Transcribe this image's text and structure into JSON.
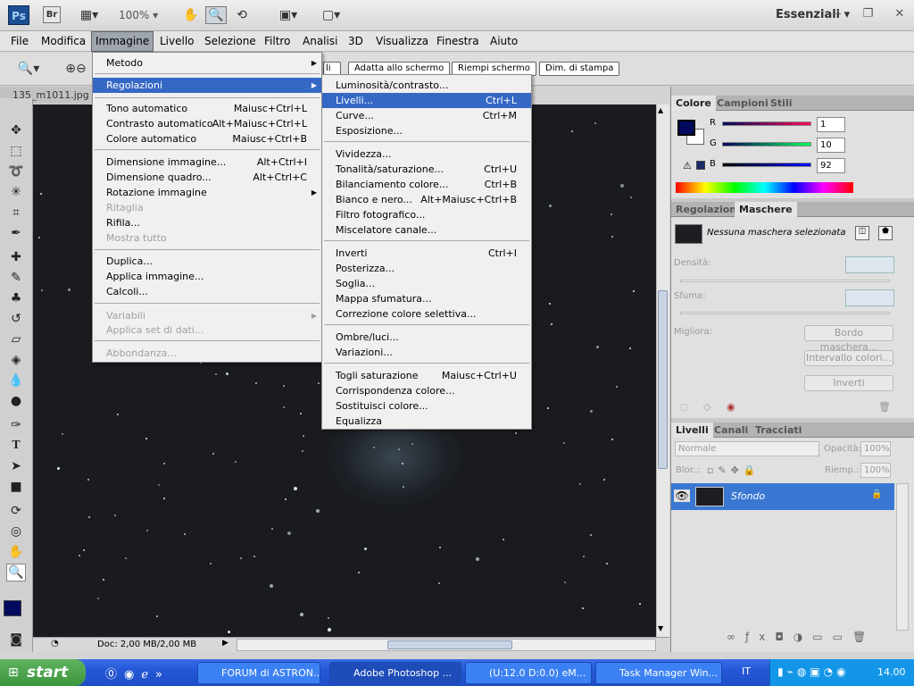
{
  "appbar": {
    "ps_label": "Ps",
    "br_label": "Br",
    "zoom": "100%",
    "workspace": "Essenziali",
    "win_controls": "– ❐ ✕"
  },
  "menubar": [
    "File",
    "Modifica",
    "Immagine",
    "Livello",
    "Selezione",
    "Filtro",
    "Analisi",
    "3D",
    "Visualizza",
    "Finestra",
    "Aiuto"
  ],
  "options": {
    "buttons": [
      "li",
      "Adatta allo schermo",
      "Riempi schermo",
      "Dim. di stampa"
    ]
  },
  "document": {
    "tab": "135_m1011.jpg",
    "status": "Doc: 2,00 MB/2,00 MB"
  },
  "immagine_menu": [
    {
      "label": "Metodo",
      "shortcut": "",
      "submenu": true,
      "disabled": false
    },
    {
      "label": "Regolazioni",
      "shortcut": "",
      "submenu": true,
      "disabled": false,
      "highlight": true
    },
    {
      "label": "Tono automatico",
      "shortcut": "Maiusc+Ctrl+L",
      "disabled": false
    },
    {
      "label": "Contrasto automatico",
      "shortcut": "Alt+Maiusc+Ctrl+L",
      "disabled": false
    },
    {
      "label": "Colore automatico",
      "shortcut": "Maiusc+Ctrl+B",
      "disabled": false
    },
    {
      "label": "Dimensione immagine...",
      "shortcut": "Alt+Ctrl+I",
      "disabled": false
    },
    {
      "label": "Dimensione quadro...",
      "shortcut": "Alt+Ctrl+C",
      "disabled": false
    },
    {
      "label": "Rotazione immagine",
      "shortcut": "",
      "submenu": true,
      "disabled": false
    },
    {
      "label": "Ritaglia",
      "shortcut": "",
      "disabled": true
    },
    {
      "label": "Rifila...",
      "shortcut": "",
      "disabled": false
    },
    {
      "label": "Mostra tutto",
      "shortcut": "",
      "disabled": true
    },
    {
      "label": "Duplica...",
      "shortcut": "",
      "disabled": false
    },
    {
      "label": "Applica immagine...",
      "shortcut": "",
      "disabled": false
    },
    {
      "label": "Calcoli...",
      "shortcut": "",
      "disabled": false
    },
    {
      "label": "Variabili",
      "shortcut": "",
      "submenu": true,
      "disabled": true
    },
    {
      "label": "Applica set di dati...",
      "shortcut": "",
      "disabled": true
    },
    {
      "label": "Abbondanza...",
      "shortcut": "",
      "disabled": true
    }
  ],
  "regolazioni_menu": [
    {
      "label": "Luminosità/contrasto...",
      "shortcut": ""
    },
    {
      "label": "Livelli...",
      "shortcut": "Ctrl+L",
      "highlight": true
    },
    {
      "label": "Curve...",
      "shortcut": "Ctrl+M"
    },
    {
      "label": "Esposizione...",
      "shortcut": ""
    },
    {
      "label": "Vividezza...",
      "shortcut": ""
    },
    {
      "label": "Tonalità/saturazione...",
      "shortcut": "Ctrl+U"
    },
    {
      "label": "Bilanciamento colore...",
      "shortcut": "Ctrl+B"
    },
    {
      "label": "Bianco e nero...",
      "shortcut": "Alt+Maiusc+Ctrl+B"
    },
    {
      "label": "Filtro fotografico...",
      "shortcut": ""
    },
    {
      "label": "Miscelatore canale...",
      "shortcut": ""
    },
    {
      "label": "Inverti",
      "shortcut": "Ctrl+I"
    },
    {
      "label": "Posterizza...",
      "shortcut": ""
    },
    {
      "label": "Soglia...",
      "shortcut": ""
    },
    {
      "label": "Mappa sfumatura...",
      "shortcut": ""
    },
    {
      "label": "Correzione colore selettiva...",
      "shortcut": ""
    },
    {
      "label": "Ombre/luci...",
      "shortcut": ""
    },
    {
      "label": "Variazioni...",
      "shortcut": ""
    },
    {
      "label": "Togli saturazione",
      "shortcut": "Maiusc+Ctrl+U"
    },
    {
      "label": "Corrispondenza colore...",
      "shortcut": ""
    },
    {
      "label": "Sostituisci colore...",
      "shortcut": ""
    },
    {
      "label": "Equalizza",
      "shortcut": ""
    }
  ],
  "color_panel": {
    "tabs": [
      "Colore",
      "Campioni",
      "Stili"
    ],
    "r_label": "R",
    "g_label": "G",
    "b_label": "B",
    "r": "1",
    "g": "10",
    "b": "92",
    "fg_color": "#010a5c"
  },
  "masks_panel": {
    "tabs": [
      "Regolazioni",
      "Maschere"
    ],
    "status": "Nessuna maschera selezionata",
    "density_label": "Densità:",
    "feather_label": "Sfuma:",
    "refine_label": "Migliora:",
    "buttons": [
      "Bordo maschera...",
      "Intervallo colori...",
      "Inverti"
    ]
  },
  "layers_panel": {
    "tabs": [
      "Livelli",
      "Canali",
      "Tracciati"
    ],
    "blend_mode": "Normale",
    "opacity_label": "Opacità:",
    "opacity": "100%",
    "lock_label": "Bloc.:",
    "fill_label": "Riemp.:",
    "fill": "100%",
    "layer_name": "Sfondo"
  },
  "taskbar": {
    "start": "start",
    "tasks": [
      "FORUM di ASTRON...",
      "Adobe Photoshop ...",
      "(U:12.0 D:0.0) eM...",
      "Task Manager Win..."
    ],
    "language": "IT",
    "clock": "14.00"
  }
}
